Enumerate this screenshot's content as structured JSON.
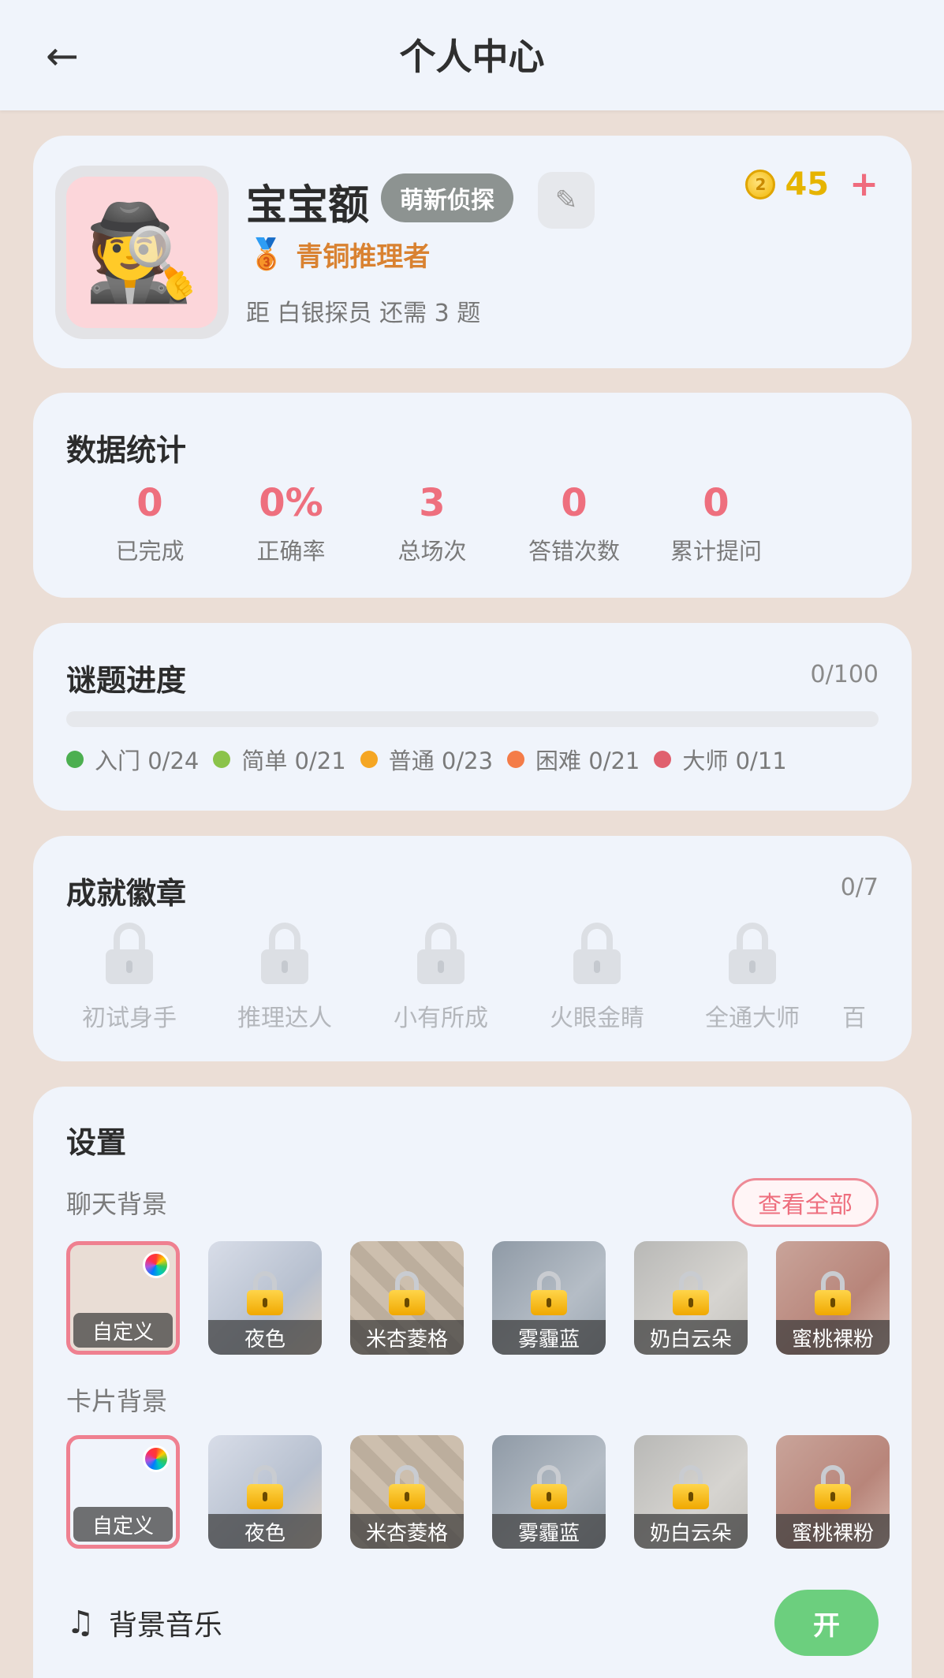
{
  "header": {
    "back_icon": "back-arrow-icon",
    "title": "个人中心"
  },
  "profile": {
    "avatar_emoji": "🕵️",
    "username": "宝宝额",
    "rank": "萌新侦探",
    "edit_icon": "pencil-icon",
    "coin_symbol": "2",
    "coins": "45",
    "coin_plus": "+",
    "medal_emoji": "🥉",
    "title": "青铜推理者",
    "next_level": "距 白银探员 还需 3 题"
  },
  "stats": {
    "heading": "数据统计",
    "items": [
      {
        "value": "0",
        "label": "已完成"
      },
      {
        "value": "0%",
        "label": "正确率"
      },
      {
        "value": "3",
        "label": "总场次"
      },
      {
        "value": "0",
        "label": "答错次数"
      },
      {
        "value": "0",
        "label": "累计提问"
      }
    ]
  },
  "progress": {
    "heading": "谜题进度",
    "count": "0/100",
    "fill_fraction": 0,
    "legend": [
      {
        "label": "入门 0/24",
        "color": "#4caf50"
      },
      {
        "label": "简单 0/21",
        "color": "#8bc34a"
      },
      {
        "label": "普通 0/23",
        "color": "#f5a623"
      },
      {
        "label": "困难 0/21",
        "color": "#f47c48"
      },
      {
        "label": "大师 0/11",
        "color": "#e0606e"
      }
    ]
  },
  "badges": {
    "heading": "成就徽章",
    "count": "0/7",
    "items": [
      {
        "label": "初试身手"
      },
      {
        "label": "推理达人"
      },
      {
        "label": "小有所成"
      },
      {
        "label": "火眼金睛"
      },
      {
        "label": "全通大师"
      },
      {
        "label": "百"
      }
    ]
  },
  "settings": {
    "heading": "设置",
    "chat_bg_label": "聊天背景",
    "view_all": "查看全部",
    "card_bg_label": "卡片背景",
    "chat_backgrounds": [
      {
        "label": "自定义",
        "locked": false,
        "selected": true
      },
      {
        "label": "夜色",
        "locked": true
      },
      {
        "label": "米杏菱格",
        "locked": true
      },
      {
        "label": "雾霾蓝",
        "locked": true
      },
      {
        "label": "奶白云朵",
        "locked": true
      },
      {
        "label": "蜜桃裸粉",
        "locked": true
      }
    ],
    "card_backgrounds": [
      {
        "label": "自定义",
        "locked": false,
        "selected": true
      },
      {
        "label": "夜色",
        "locked": true
      },
      {
        "label": "米杏菱格",
        "locked": true
      },
      {
        "label": "雾霾蓝",
        "locked": true
      },
      {
        "label": "奶白云朵",
        "locked": true
      },
      {
        "label": "蜜桃裸粉",
        "locked": true
      }
    ],
    "music_icon": "♫",
    "music_label": "背景音乐",
    "music_toggle": "开"
  }
}
